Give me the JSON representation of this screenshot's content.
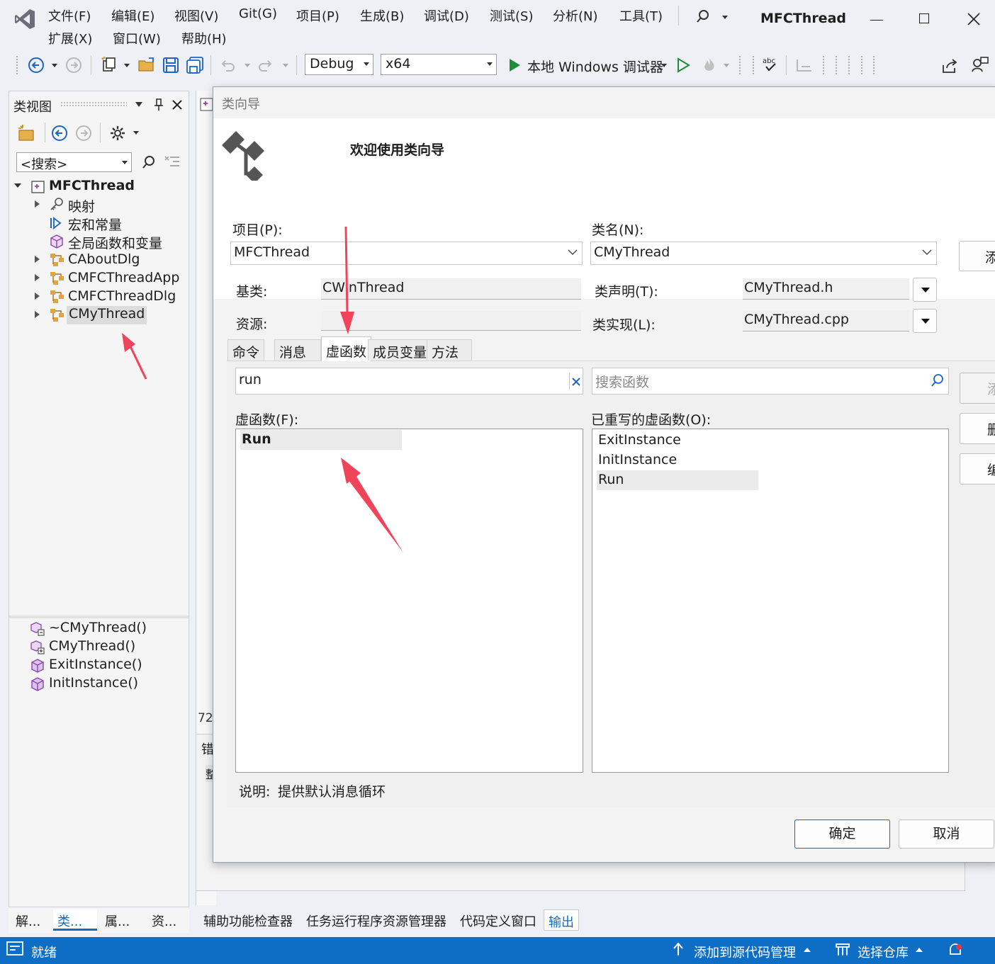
{
  "app": {
    "window_title": "MFCThread",
    "menu": [
      "文件(F)",
      "编辑(E)",
      "视图(V)",
      "Git(G)",
      "项目(P)",
      "生成(B)",
      "调试(D)",
      "测试(S)",
      "分析(N)",
      "工具(T)"
    ],
    "menu_row2": [
      "扩展(X)",
      "窗口(W)",
      "帮助(H)"
    ]
  },
  "toolbar": {
    "config": "Debug",
    "platform": "x64",
    "run_label": "本地 Windows 调试器"
  },
  "class_view": {
    "title": "类视图",
    "search_placeholder": "<搜索>",
    "tree": [
      {
        "label": "MFCThread",
        "bold": true
      },
      {
        "label": "映射"
      },
      {
        "label": "宏和常量"
      },
      {
        "label": "全局函数和变量"
      },
      {
        "label": "CAboutDlg"
      },
      {
        "label": "CMFCThreadApp"
      },
      {
        "label": "CMFCThreadDlg"
      },
      {
        "label": "CMyThread"
      }
    ],
    "members": [
      "~CMyThread()",
      "CMyThread()",
      "ExitInstance()",
      "InitInstance()"
    ]
  },
  "dialog": {
    "title": "类向导",
    "welcome": "欢迎使用类向导",
    "project_label": "项目(P):",
    "project_value": "MFCThread",
    "classname_label": "类名(N):",
    "classname_value": "CMyThread",
    "add_class_partial": "添",
    "base_label": "基类:",
    "base_value": "CWinThread",
    "resource_label": "资源:",
    "resource_value": "",
    "decl_label": "类声明(T):",
    "decl_value": "CMyThread.h",
    "impl_label": "类实现(L):",
    "impl_value": "CMyThread.cpp",
    "tabs": [
      "命令",
      "消息",
      "虚函数",
      "成员变量",
      "方法"
    ],
    "active_tab": "虚函数",
    "filter_value": "run",
    "search_placeholder": "搜索函数",
    "virtual_label": "虚函数(F):",
    "virtual_items": [
      "Run"
    ],
    "overridden_label": "已重写的虚函数(O):",
    "overridden_items": [
      "ExitInstance",
      "InitInstance",
      "Run"
    ],
    "side_buttons_partial": [
      "添",
      "删",
      "编"
    ],
    "description_label": "说明:",
    "description_value": "提供默认消息循环",
    "ok": "确定",
    "cancel": "取消"
  },
  "background_editor": {
    "line_fragment": "72",
    "panel_fragment_1": "错",
    "panel_fragment_2": "整"
  },
  "bottom_tabs_left": [
    "解...",
    "类...",
    "属...",
    "资..."
  ],
  "bottom_tabs": [
    "辅助功能检查器",
    "任务运行程序资源管理器",
    "代码定义窗口",
    "输出"
  ],
  "status": {
    "ready": "就绪",
    "add_to_source": "添加到源代码管理",
    "select_repo": "选择仓库"
  },
  "colors": {
    "status_bar": "#0e6dc4",
    "accent": "#0e6dc4",
    "annotation_arrow": "#f0445a"
  }
}
